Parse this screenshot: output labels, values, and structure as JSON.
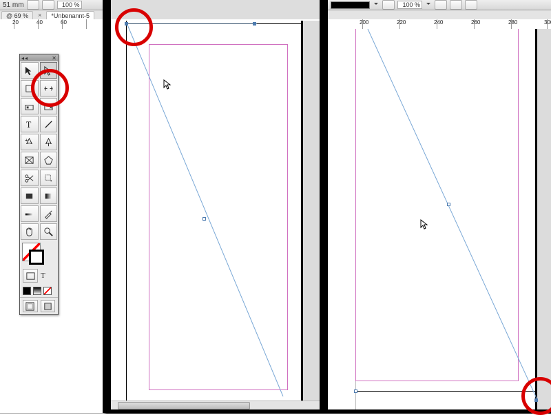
{
  "panelA": {
    "ruler_val": "51 mm",
    "zoom": "100 %",
    "tabzoom": "@ 69 %",
    "tabname": "*Unbenannt-5",
    "ruler_ticks": [
      "20",
      "40",
      "60"
    ]
  },
  "panelB": {
    "ruler_ticks": []
  },
  "panelC": {
    "zoom": "100 %",
    "ruler_ticks": [
      "200",
      "220",
      "240",
      "260",
      "280",
      "300"
    ]
  },
  "tools": {
    "rows": [
      [
        "selection-arrow",
        "direct-selection-arrow"
      ],
      [
        "page-tool",
        "gap-tool"
      ],
      [
        "content-collector",
        "content-placer"
      ],
      [
        "type-tool",
        "type-on-path-tool"
      ],
      [
        "line-tool",
        "pen-tool"
      ],
      [
        "rectangle-frame-tool",
        "polygon-tool"
      ],
      [
        "scissors-tool",
        "free-transform-tool"
      ],
      [
        "rectangle-tool",
        "gradient-swatch-tool"
      ],
      [
        "gradient-feather-tool",
        "eyedropper-tool"
      ],
      [
        "hand-tool",
        "zoom-tool"
      ]
    ],
    "bottom_mini": [
      "fill",
      "stroke",
      "none"
    ],
    "viewmode": [
      "normal",
      "preview"
    ]
  }
}
